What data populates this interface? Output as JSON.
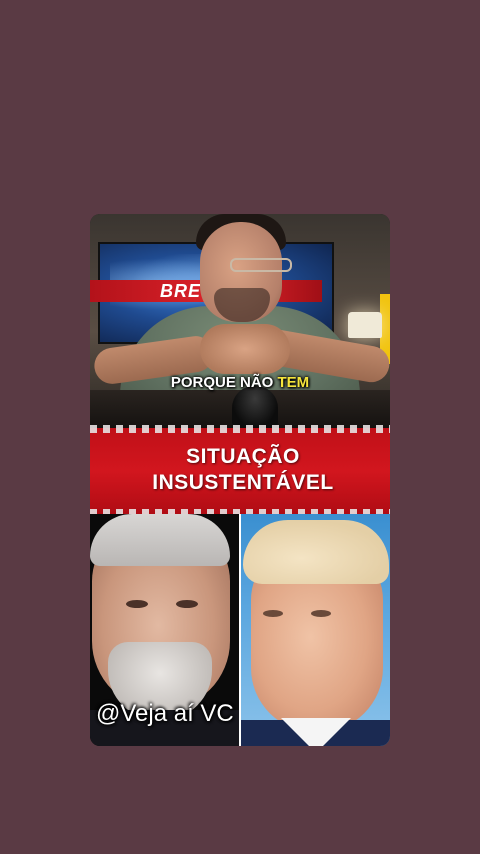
{
  "video": {
    "studio_screen_text": "BRE",
    "subtitle_prefix": "PORQUE NÃO ",
    "subtitle_highlight": "TEM",
    "headline_line1": "SITUAÇÃO",
    "headline_line2": "INSUSTENTÁVEL",
    "watermark": "@Veja aí VC"
  },
  "colors": {
    "background": "#5a3a44",
    "banner_red": "#d2161e",
    "subtitle_highlight": "#f5e53c"
  }
}
